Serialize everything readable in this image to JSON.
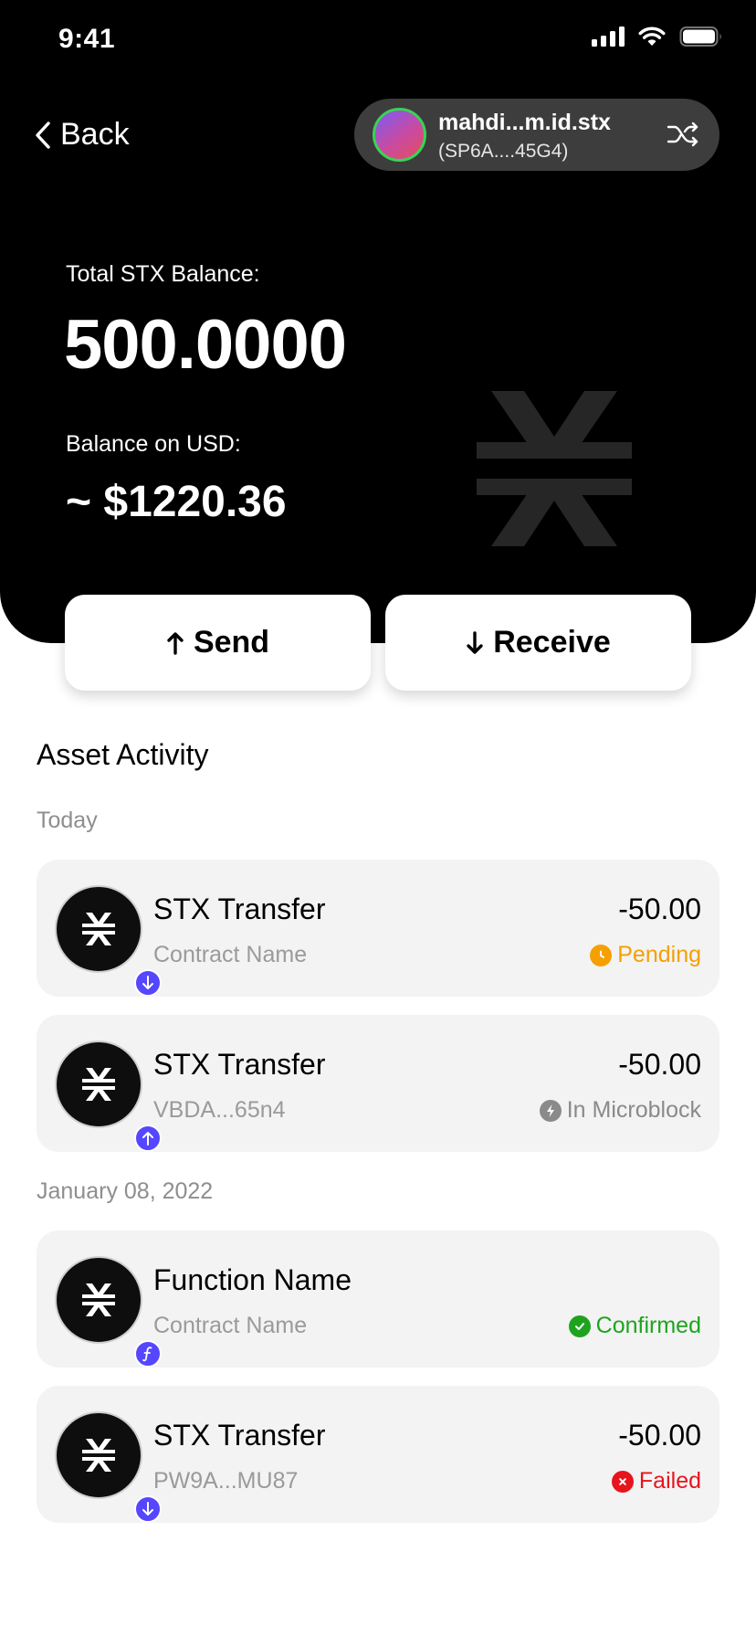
{
  "status_bar": {
    "time": "9:41"
  },
  "nav": {
    "back_label": "Back"
  },
  "account": {
    "name": "mahdi...m.id.stx",
    "address": "(SP6A....45G4)"
  },
  "balance": {
    "stx_label": "Total STX Balance:",
    "stx_value": "500.0000",
    "usd_label": "Balance on USD:",
    "usd_value": "~ $1220.36"
  },
  "actions": {
    "send_label": "Send",
    "receive_label": "Receive"
  },
  "activity": {
    "title": "Asset Activity",
    "groups": [
      {
        "label": "Today",
        "items": [
          {
            "title": "STX Transfer",
            "subtitle": "Contract Name",
            "amount": "-50.00",
            "status": "Pending",
            "status_color": "#f5a000",
            "direction": "in"
          },
          {
            "title": "STX Transfer",
            "subtitle": "VBDA...65n4",
            "amount": "-50.00",
            "status": "In Microblock",
            "status_color": "#8a8a8a",
            "direction": "out"
          }
        ]
      },
      {
        "label": "January 08, 2022",
        "items": [
          {
            "title": "Function Name",
            "subtitle": "Contract Name",
            "amount": "",
            "status": "Confirmed",
            "status_color": "#1fa31f",
            "direction": "function"
          },
          {
            "title": "STX Transfer",
            "subtitle": "PW9A...MU87",
            "amount": "-50.00",
            "status": "Failed",
            "status_color": "#e8141c",
            "direction": "in"
          }
        ]
      }
    ]
  },
  "colors": {
    "badge": "#5546ff",
    "hero_bg": "#000000",
    "card_bg": "#f3f3f3"
  }
}
